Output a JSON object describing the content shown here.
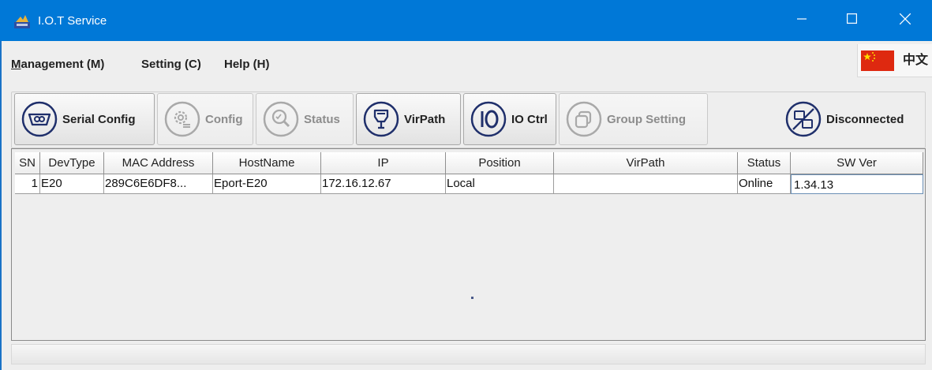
{
  "window": {
    "title": "I.O.T Service",
    "accent_color": "#0078d7",
    "controls": [
      "minimize-icon",
      "maximize-icon",
      "close-icon"
    ]
  },
  "menu": {
    "items": [
      {
        "label": "Management (M)",
        "mnemonic": "M",
        "rest": "anagement (M)"
      },
      {
        "label": "Setting (C)"
      },
      {
        "label": "Help (H)"
      }
    ]
  },
  "language": {
    "flag_icon": "china-flag-icon",
    "label": "中文"
  },
  "toolbar": {
    "buttons": [
      {
        "label": "Serial Config",
        "icon": "serial-port-icon",
        "enabled": true
      },
      {
        "label": "Config",
        "icon": "gear-config-icon",
        "enabled": false
      },
      {
        "label": "Status",
        "icon": "status-search-icon",
        "enabled": false
      },
      {
        "label": "VirPath",
        "icon": "plug-icon",
        "enabled": true
      },
      {
        "label": "IO Ctrl",
        "icon": "io-icon",
        "enabled": true
      },
      {
        "label": "Group Setting",
        "icon": "group-icon",
        "enabled": false
      },
      {
        "label": "Disconnected",
        "icon": "disconnected-icon",
        "enabled": true
      }
    ]
  },
  "table": {
    "columns": [
      "SN",
      "DevType",
      "MAC Address",
      "HostName",
      "IP",
      "Position",
      "VirPath",
      "Status",
      "SW Ver"
    ],
    "rows": [
      {
        "SN": "1",
        "DevType": "E20",
        "MAC Address": "289C6E6DF8...",
        "HostName": "Eport-E20",
        "IP": "172.16.12.67",
        "Position": "Local",
        "VirPath": "",
        "Status": "Online",
        "SW Ver": "1.34.13"
      }
    ]
  }
}
